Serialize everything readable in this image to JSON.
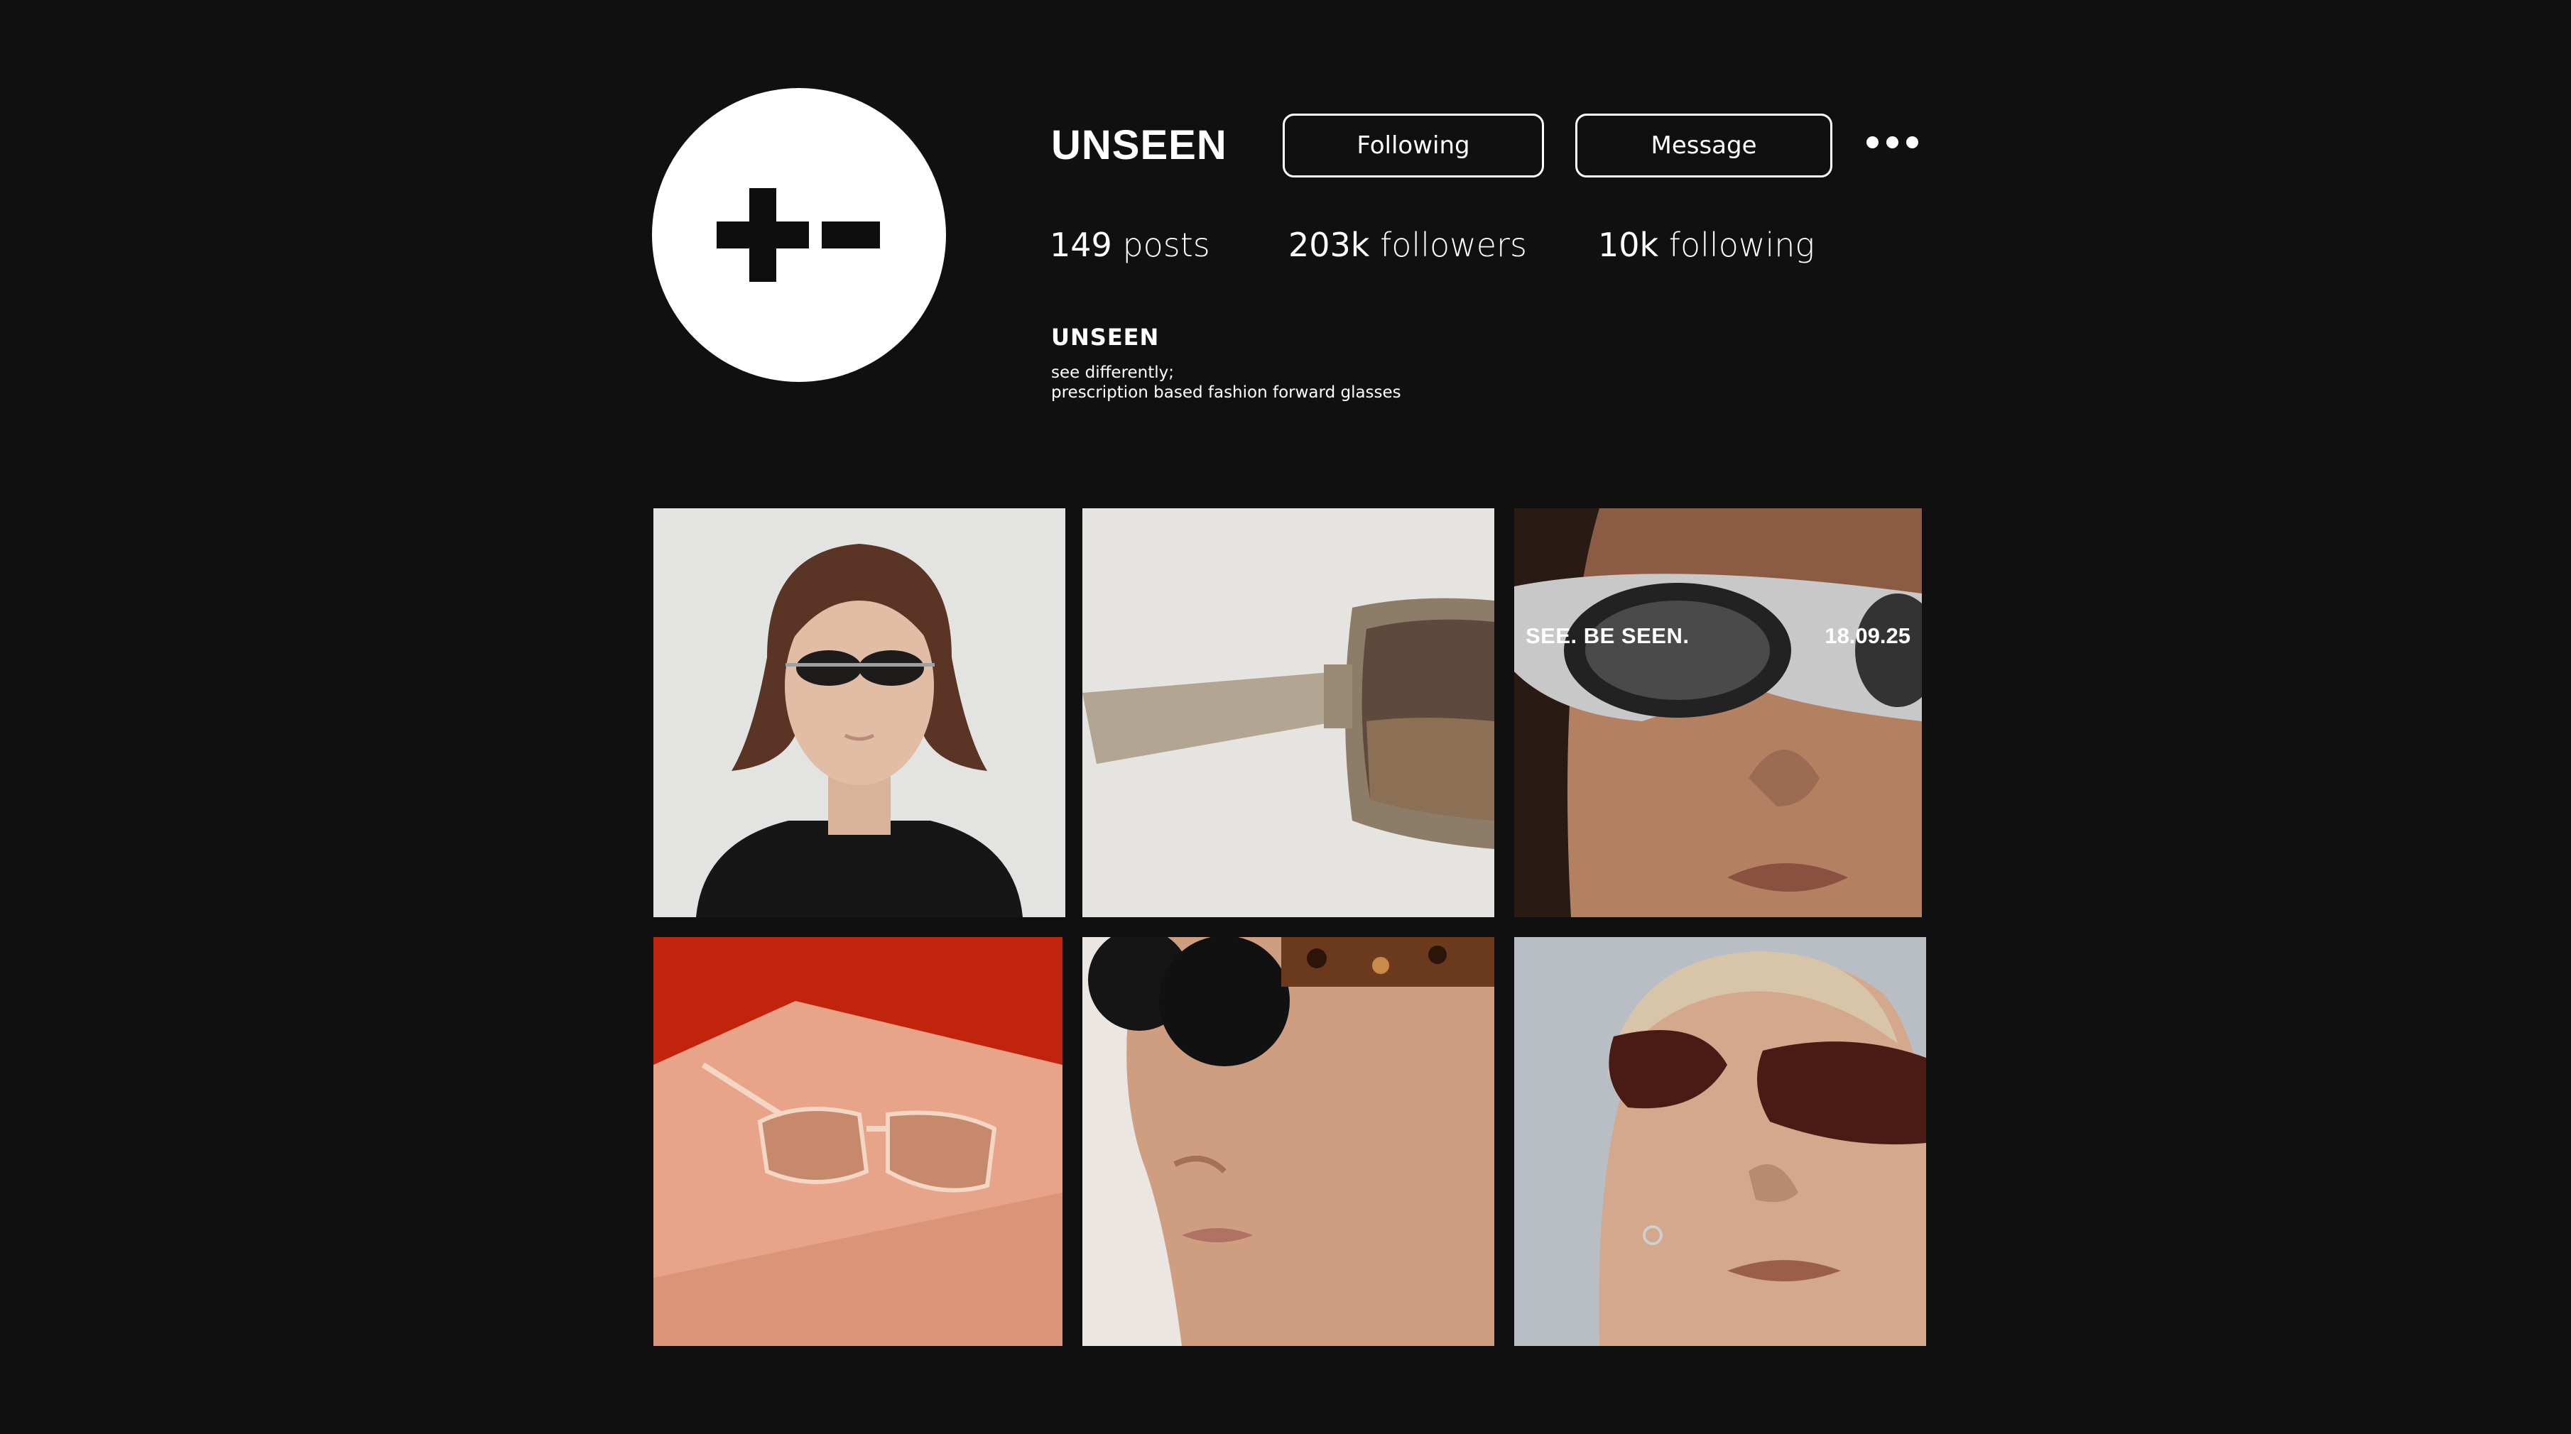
{
  "profile": {
    "username": "UNSEEN",
    "following_label": "Following",
    "message_label": "Message",
    "more_icon": "more-horizontal-icon",
    "avatar_icon": "plus-minus-logo"
  },
  "stats": {
    "posts_count": "149",
    "posts_label": "posts",
    "followers_count": "203k",
    "followers_label": "followers",
    "following_count": "10k",
    "following_label": "following"
  },
  "bio": {
    "name": "UNSEEN",
    "line1": "see differently;",
    "line2": "prescription based fashion forward glasses"
  },
  "posts": [
    {
      "id": 1
    },
    {
      "id": 2
    },
    {
      "id": 3,
      "overlay_left": "SEE. BE SEEN.",
      "overlay_right": "18.09.25"
    },
    {
      "id": 4
    },
    {
      "id": 5
    },
    {
      "id": 6
    }
  ],
  "colors": {
    "background": "#101010",
    "text": "#ffffff",
    "accent_red": "#c0240c"
  }
}
